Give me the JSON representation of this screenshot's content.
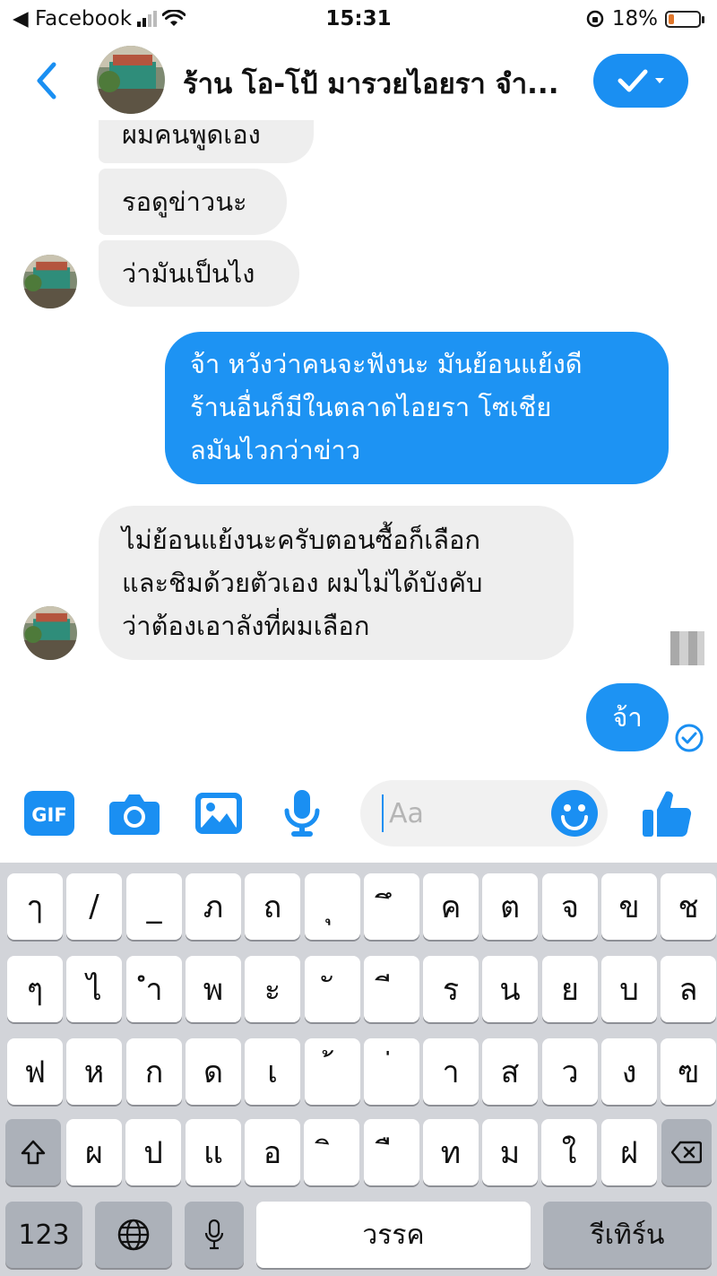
{
  "status_bar": {
    "back_app": "◀ Facebook",
    "time": "15:31",
    "battery_percent": "18%",
    "battery_level": 0.18
  },
  "header": {
    "title": "ร้าน โอ-โป้ มารวยไอยรา จำ...",
    "accent_color": "#1a8ff2"
  },
  "messages": [
    {
      "side": "in",
      "text": "ผมคนพูดเอง"
    },
    {
      "side": "in",
      "text": "รอดูข่าวนะ"
    },
    {
      "side": "in",
      "text": "ว่ามันเป็นไง"
    },
    {
      "side": "out",
      "lines": [
        "จ้า หวังว่าคนจะฟังนะ มันย้อนแย้งดี",
        "ร้านอื่นก็มีในตลาดไอยรา โซเชีย",
        "ลมันไวกว่าข่าว"
      ]
    },
    {
      "side": "in",
      "lines": [
        "ไม่ย้อนแย้งนะครับตอนซื้อก็เลือก",
        "และชิมด้วยตัวเอง ผมไม่ได้บังคับ",
        "ว่าต้องเอาลังที่ผมเลือก"
      ]
    },
    {
      "side": "out",
      "text": "จ้า"
    }
  ],
  "composer": {
    "gif_label": "GIF",
    "placeholder": "Aa",
    "icons": [
      "gif-icon",
      "camera-icon",
      "image-icon",
      "microphone-icon",
      "emoji-icon",
      "thumbs-up-icon"
    ]
  },
  "keyboard": {
    "row1": [
      "ๅ",
      "/",
      "_",
      "ภ",
      "ถ",
      "ุ",
      "ึ",
      "ค",
      "ต",
      "จ",
      "ข",
      "ช"
    ],
    "row2": [
      "ๆ",
      "ไ",
      "ำ",
      "พ",
      "ะ",
      "ั",
      "ี",
      "ร",
      "น",
      "ย",
      "บ",
      "ล"
    ],
    "row3": [
      "ฟ",
      "ห",
      "ก",
      "ด",
      "เ",
      "้",
      "่",
      "า",
      "ส",
      "ว",
      "ง",
      "ฃ"
    ],
    "row4": [
      "ผ",
      "ป",
      "แ",
      "อ",
      "ิ",
      "ื",
      "ท",
      "ม",
      "ใ",
      "ฝ"
    ],
    "numbers_label": "123",
    "space_label": "วรรค",
    "return_label": "รีเทิร์น"
  }
}
